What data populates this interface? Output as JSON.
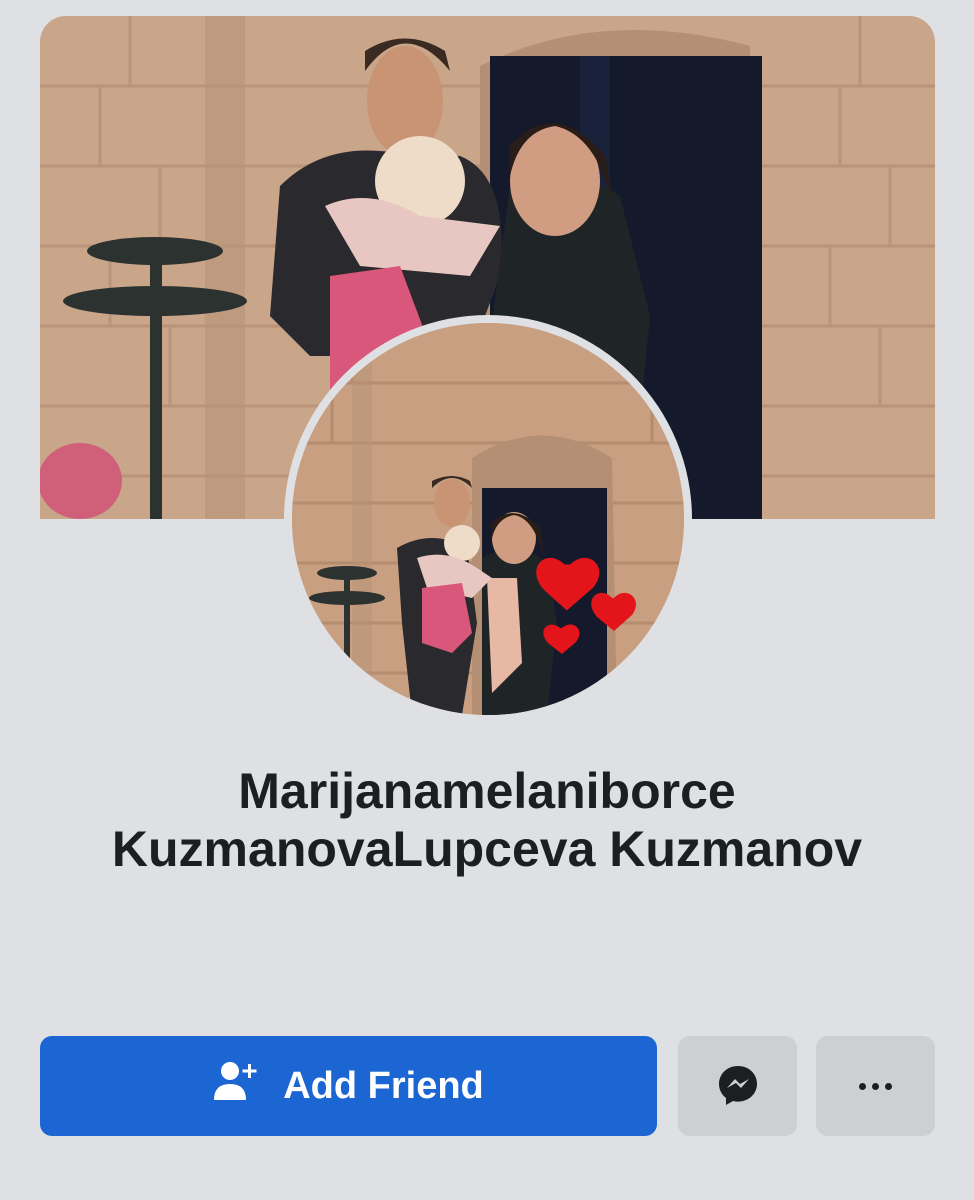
{
  "profile": {
    "name_line1": "Marijanamelaniborce",
    "name_line2": "KuzmanovaLupceva Kuzmanov"
  },
  "actions": {
    "add_friend_label": "Add Friend",
    "add_friend_icon": "add-person-icon",
    "message_icon": "messenger-icon",
    "more_icon": "more-dots-icon"
  },
  "colors": {
    "background": "#dfe0e3",
    "primary_button": "#1b66d2",
    "secondary_button": "#cdcfd3",
    "heart": "#e3151b"
  }
}
